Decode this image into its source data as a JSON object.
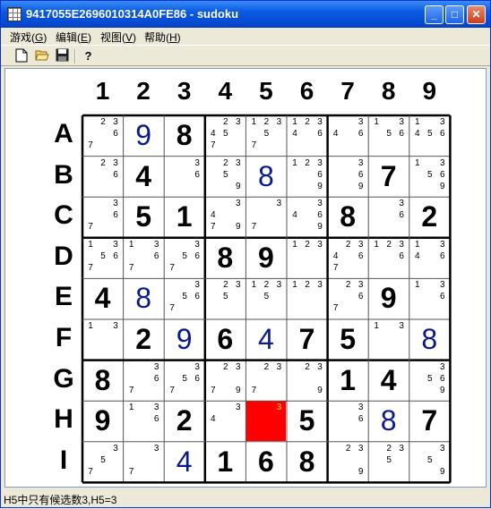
{
  "window": {
    "title": "9417055E2696010314A0FE86 - sudoku"
  },
  "menu": [
    {
      "label": "游戏(",
      "key": "G",
      "tail": ")"
    },
    {
      "label": "编辑(",
      "key": "E",
      "tail": ")"
    },
    {
      "label": "视图(",
      "key": "V",
      "tail": ")"
    },
    {
      "label": "帮助(",
      "key": "H",
      "tail": ")"
    }
  ],
  "toolbar": [
    "new-icon",
    "open-icon",
    "save-icon",
    "help-icon"
  ],
  "columns": [
    "1",
    "2",
    "3",
    "4",
    "5",
    "6",
    "7",
    "8",
    "9"
  ],
  "rows": [
    "A",
    "B",
    "C",
    "D",
    "E",
    "F",
    "G",
    "H",
    "I"
  ],
  "grid": [
    [
      {
        "c": [
          2,
          3,
          6,
          7
        ]
      },
      {
        "u": "9"
      },
      {
        "v": "8"
      },
      {
        "c": [
          2,
          3,
          4,
          5,
          7
        ]
      },
      {
        "c": [
          1,
          2,
          3,
          5,
          7
        ]
      },
      {
        "c": [
          1,
          2,
          3,
          4,
          6
        ]
      },
      {
        "c": [
          3,
          4,
          6
        ]
      },
      {
        "c": [
          1,
          3,
          5,
          6
        ]
      },
      {
        "c": [
          1,
          3,
          4,
          5,
          6
        ]
      }
    ],
    [
      {
        "c": [
          2,
          3,
          6
        ]
      },
      {
        "v": "4"
      },
      {
        "c": [
          3,
          6
        ]
      },
      {
        "c": [
          2,
          3,
          5,
          9
        ]
      },
      {
        "u": "8"
      },
      {
        "c": [
          1,
          2,
          3,
          6,
          9
        ]
      },
      {
        "c": [
          3,
          6,
          9
        ]
      },
      {
        "v": "7"
      },
      {
        "c": [
          1,
          3,
          5,
          6,
          9
        ]
      }
    ],
    [
      {
        "c": [
          3,
          6,
          7
        ]
      },
      {
        "v": "5"
      },
      {
        "v": "1"
      },
      {
        "c": [
          3,
          4,
          7,
          9
        ]
      },
      {
        "c": [
          3,
          7
        ]
      },
      {
        "c": [
          3,
          4,
          6,
          9
        ]
      },
      {
        "v": "8"
      },
      {
        "c": [
          3,
          6
        ]
      },
      {
        "v": "2"
      }
    ],
    [
      {
        "c": [
          1,
          3,
          5,
          6,
          7
        ]
      },
      {
        "c": [
          1,
          3,
          6,
          7
        ]
      },
      {
        "c": [
          3,
          5,
          6,
          7
        ]
      },
      {
        "v": "8"
      },
      {
        "v": "9"
      },
      {
        "c": [
          1,
          2,
          3
        ]
      },
      {
        "c": [
          2,
          3,
          4,
          6,
          7
        ]
      },
      {
        "c": [
          1,
          2,
          3,
          6
        ]
      },
      {
        "c": [
          1,
          3,
          4,
          6
        ]
      }
    ],
    [
      {
        "v": "4"
      },
      {
        "u": "8"
      },
      {
        "c": [
          3,
          5,
          6,
          7
        ]
      },
      {
        "c": [
          2,
          3,
          5
        ]
      },
      {
        "c": [
          1,
          2,
          3,
          5
        ]
      },
      {
        "c": [
          1,
          2,
          3
        ]
      },
      {
        "c": [
          2,
          3,
          6,
          7
        ]
      },
      {
        "v": "9"
      },
      {
        "c": [
          1,
          3,
          6
        ]
      }
    ],
    [
      {
        "c": [
          1,
          3
        ]
      },
      {
        "v": "2"
      },
      {
        "u": "9"
      },
      {
        "v": "6"
      },
      {
        "u": "4"
      },
      {
        "v": "7"
      },
      {
        "v": "5"
      },
      {
        "c": [
          1,
          3
        ]
      },
      {
        "u": "8"
      }
    ],
    [
      {
        "v": "8"
      },
      {
        "c": [
          3,
          6,
          7
        ]
      },
      {
        "c": [
          3,
          5,
          6,
          7
        ]
      },
      {
        "c": [
          2,
          3,
          7,
          9
        ]
      },
      {
        "c": [
          2,
          3,
          7
        ]
      },
      {
        "c": [
          2,
          3,
          9
        ]
      },
      {
        "v": "1"
      },
      {
        "v": "4"
      },
      {
        "c": [
          3,
          5,
          6,
          9
        ]
      }
    ],
    [
      {
        "v": "9"
      },
      {
        "c": [
          1,
          3,
          6
        ]
      },
      {
        "v": "2"
      },
      {
        "c": [
          3,
          4
        ]
      },
      {
        "c": [
          3
        ],
        "sel": true
      },
      {
        "v": "5"
      },
      {
        "c": [
          3,
          6
        ]
      },
      {
        "u": "8"
      },
      {
        "v": "7"
      }
    ],
    [
      {
        "c": [
          3,
          5,
          7
        ]
      },
      {
        "c": [
          3,
          7
        ]
      },
      {
        "u": "4"
      },
      {
        "v": "1"
      },
      {
        "v": "6"
      },
      {
        "v": "8"
      },
      {
        "c": [
          2,
          3,
          9
        ]
      },
      {
        "c": [
          2,
          3,
          5
        ]
      },
      {
        "c": [
          3,
          5,
          9
        ]
      }
    ]
  ],
  "status": {
    "text": "H5中只有候选数3,H5=3"
  },
  "colors": {
    "selected_cell": "#FF0000",
    "selected_candidate": "#FFE000",
    "user_digit": "#0A1A8C"
  }
}
